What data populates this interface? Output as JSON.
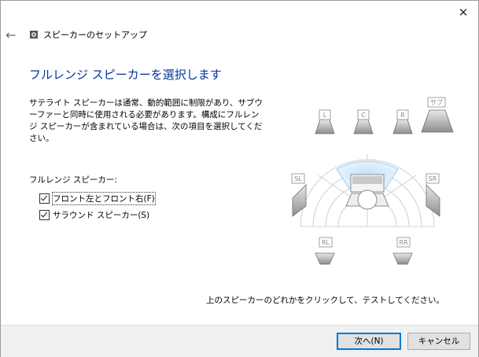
{
  "window": {
    "title": "スピーカーのセットアップ"
  },
  "heading": "フルレンジ スピーカーを選択します",
  "description": "サテライト スピーカーは通常、動的範囲に制限があり、サブウーファーと同時に使用される必要があります。構成にフルレンジ スピーカーが含まれている場合は、次の項目を選択してください。",
  "section_label": "フルレンジ スピーカー:",
  "options": [
    {
      "label": "フロント左とフロント右(F)",
      "checked": true
    },
    {
      "label": "サラウンド スピーカー(S)",
      "checked": true
    }
  ],
  "speakers": {
    "L": "L",
    "C": "C",
    "R": "R",
    "Sub": "サブ",
    "SL": "SL",
    "SR": "SR",
    "RL": "RL",
    "RR": "RR"
  },
  "hint": "上のスピーカーのどれかをクリックして、テストしてください。",
  "buttons": {
    "next": "次へ(N)",
    "cancel": "キャンセル"
  },
  "icons": {
    "back": "back-arrow-icon",
    "close": "close-icon",
    "app": "speaker-app-icon"
  },
  "colors": {
    "heading": "#003399",
    "highlight": "#cfe8fb",
    "primary_border": "#0078d7"
  }
}
